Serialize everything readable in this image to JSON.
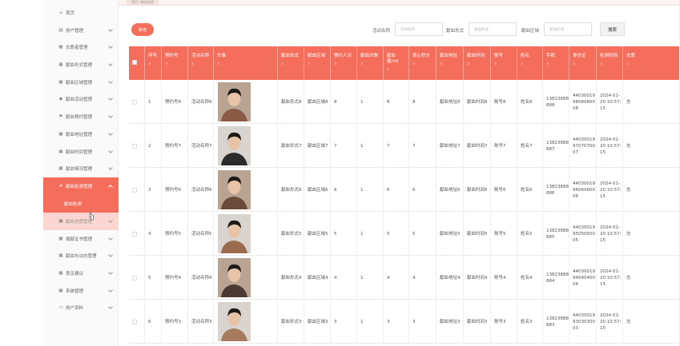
{
  "breadcrumb": {
    "tab": "首页 / 献血检测"
  },
  "sidebar": {
    "items": [
      {
        "label": "首页",
        "icon": "home-icon",
        "glyph": "⌂",
        "chevron": false
      },
      {
        "label": "用户管理",
        "icon": "user-icon",
        "glyph": "▤",
        "chevron": true
      },
      {
        "label": "志愿者管理",
        "icon": "grid-icon",
        "glyph": "▦",
        "chevron": true
      },
      {
        "label": "献血形式管理",
        "icon": "grid-icon",
        "glyph": "▦",
        "chevron": true
      },
      {
        "label": "献血区域管理",
        "icon": "grid-icon",
        "glyph": "▦",
        "chevron": true
      },
      {
        "label": "献血活动管理",
        "icon": "shield-icon",
        "glyph": "◆",
        "chevron": true
      },
      {
        "label": "献血预约管理",
        "icon": "flag-icon",
        "glyph": "⚑",
        "chevron": true
      },
      {
        "label": "献血地址管理",
        "icon": "grid-icon",
        "glyph": "▦",
        "chevron": true
      },
      {
        "label": "献血时间管理",
        "icon": "grid-icon",
        "glyph": "▦",
        "chevron": true
      },
      {
        "label": "献血情况管理",
        "icon": "grid-icon",
        "glyph": "▦",
        "chevron": true
      },
      {
        "label": "献血检测管理",
        "icon": "send-icon",
        "glyph": "➤",
        "chevron": true,
        "active": true
      },
      {
        "label": "献血进度管理",
        "icon": "grid-icon",
        "glyph": "▦",
        "chevron": true
      },
      {
        "label": "捐献证书管理",
        "icon": "grid-icon",
        "glyph": "▦",
        "chevron": true
      },
      {
        "label": "献血车动态管理",
        "icon": "grid-icon",
        "glyph": "▦",
        "chevron": true
      },
      {
        "label": "意见建议",
        "icon": "grid-icon",
        "glyph": "▦",
        "chevron": true
      },
      {
        "label": "系统管理",
        "icon": "grid-icon",
        "glyph": "▦",
        "chevron": true
      },
      {
        "label": "用户资料",
        "icon": "doc-icon",
        "glyph": "▭",
        "chevron": true
      }
    ],
    "submenu": {
      "label": "献血检测"
    }
  },
  "toolbar": {
    "add_label": "新增",
    "search_label": "搜索",
    "filters": [
      {
        "label": "活动名称",
        "placeholder": "活动名称"
      },
      {
        "label": "献血形式",
        "placeholder": "献血形式"
      },
      {
        "label": "献血区域",
        "placeholder": "献血区域"
      }
    ]
  },
  "table": {
    "sort_mark": "⇕",
    "columns": [
      "序号",
      "预约号",
      "活动名称",
      "头像",
      "献血形式",
      "献血区域",
      "预约人次",
      "献血次数",
      "献血量/ml",
      "爱心积分",
      "献血地址",
      "献血时间",
      "账号",
      "姓名",
      "手机",
      "身份证",
      "检测时间",
      "志愿"
    ],
    "rows": [
      {
        "idx": "1",
        "no": "预约号8",
        "name": "活动名称8",
        "form": "献血形式8",
        "area": "献血区域8",
        "people": "8",
        "times": "1",
        "amount": "8",
        "points": "8",
        "addr": "献血地址8",
        "time": "献血时间8",
        "account": "账号8",
        "realname": "姓名8",
        "phone": "13823888888",
        "id": "440300199808080008",
        "check": "2024-01-20 10:57:15",
        "vol": "志"
      },
      {
        "idx": "2",
        "no": "预约号7",
        "name": "活动名称7",
        "form": "献血形式7",
        "area": "献血区域7",
        "people": "7",
        "times": "1",
        "amount": "7",
        "points": "7",
        "addr": "献血地址7",
        "time": "献血时间7",
        "account": "账号7",
        "realname": "姓名7",
        "phone": "13823888887",
        "id": "440300199707070007",
        "check": "2024-01-20 10:57:15",
        "vol": "志"
      },
      {
        "idx": "3",
        "no": "预约号6",
        "name": "活动名称6",
        "form": "献血形式6",
        "area": "献血区域6",
        "people": "6",
        "times": "1",
        "amount": "6",
        "points": "6",
        "addr": "献血地址6",
        "time": "献血时间6",
        "account": "账号6",
        "realname": "姓名6",
        "phone": "13823888886",
        "id": "440300199606060006",
        "check": "2024-01-20 10:57:15",
        "vol": "志"
      },
      {
        "idx": "4",
        "no": "预约号5",
        "name": "活动名称5",
        "form": "献血形式5",
        "area": "献血区域5",
        "people": "5",
        "times": "1",
        "amount": "5",
        "points": "5",
        "addr": "献血地址5",
        "time": "献血时间5",
        "account": "账号5",
        "realname": "姓名5",
        "phone": "13823888885",
        "id": "440300199505050005",
        "check": "2024-01-20 10:57:15",
        "vol": "志"
      },
      {
        "idx": "5",
        "no": "预约号4",
        "name": "活动名称4",
        "form": "献血形式4",
        "area": "献血区域4",
        "people": "4",
        "times": "1",
        "amount": "4",
        "points": "4",
        "addr": "献血地址4",
        "time": "献血时间4",
        "account": "账号4",
        "realname": "姓名4",
        "phone": "13823888884",
        "id": "440300199404040004",
        "check": "2024-01-20 10:57:15",
        "vol": "志"
      },
      {
        "idx": "6",
        "no": "预约号3",
        "name": "活动名称3",
        "form": "献血形式3",
        "area": "献血区域3",
        "people": "3",
        "times": "1",
        "amount": "3",
        "points": "3",
        "addr": "献血地址3",
        "time": "献血时间3",
        "account": "账号3",
        "realname": "姓名3",
        "phone": "13823888883",
        "id": "440300199303030003",
        "check": "2024-01-20 10:57:15",
        "vol": "志"
      }
    ]
  },
  "colors": {
    "accent": "#f56e5c",
    "accent_light": "#fbd5cf"
  }
}
